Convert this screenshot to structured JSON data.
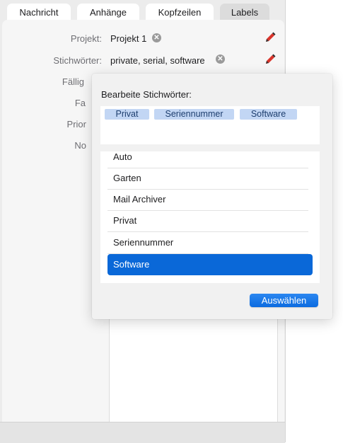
{
  "tabs": [
    {
      "label": "Nachricht"
    },
    {
      "label": "Anhänge"
    },
    {
      "label": "Kopfzeilen"
    },
    {
      "label": "Labels"
    }
  ],
  "fields": {
    "project_label": "Projekt:",
    "project_value": "Projekt 1",
    "keywords_label": "Stichwörter:",
    "keywords_value": "private, serial, software",
    "due_label": "Fällig",
    "color_label": "Fa",
    "priority_label": "Prior",
    "notes_label": "No"
  },
  "popover": {
    "title": "Bearbeite Stichwörter:",
    "tokens": [
      "Privat",
      "Seriennummer",
      "Software"
    ],
    "list": [
      {
        "label": "Auto"
      },
      {
        "label": "Garten"
      },
      {
        "label": "Mail Archiver"
      },
      {
        "label": "Privat"
      },
      {
        "label": "Seriennummer"
      },
      {
        "label": "Software"
      }
    ],
    "selected_item": "Software",
    "select_button": "Auswählen"
  },
  "icons": {
    "clear": "clear-circle-icon",
    "edit": "pencil-icon"
  },
  "colors": {
    "accent": "#0a68d8",
    "token_bg": "#c2d6f4"
  }
}
